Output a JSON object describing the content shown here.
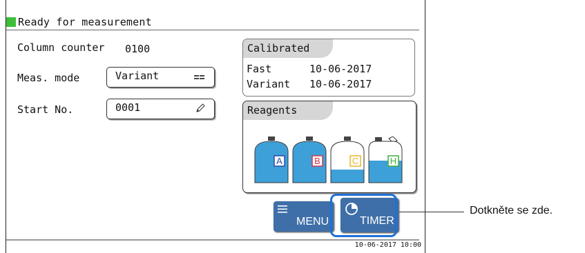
{
  "status": {
    "text": "Ready for measurement",
    "indicator_color": "#3fbe3a"
  },
  "left": {
    "column_counter_label": "Column counter",
    "column_counter_value": "0100",
    "meas_mode_label": "Meas. mode",
    "meas_mode_value": "Variant",
    "start_no_label": "Start No.",
    "start_no_value": "0001"
  },
  "calibrated": {
    "title": "Calibrated",
    "rows": [
      {
        "name": "Fast",
        "date": "10-06-2017"
      },
      {
        "name": "Variant",
        "date": "10-06-2017"
      }
    ]
  },
  "reagents": {
    "title": "Reagents",
    "bottles": [
      {
        "label": "A",
        "label_color": "#2a4aa8",
        "level": 0.9
      },
      {
        "label": "B",
        "label_color": "#d8364a",
        "level": 0.95
      },
      {
        "label": "C",
        "label_color": "#e8b72a",
        "level": 0.3
      },
      {
        "label": "H",
        "label_color": "#3fae3a",
        "level": 0.55
      }
    ]
  },
  "buttons": {
    "menu_label": "MENU",
    "menu_icon": "hamburger-icon",
    "timer_label": "TIMER",
    "timer_icon": "clock-icon",
    "color": "#3f6fa8"
  },
  "timestamp": "10-06-2017 10:00",
  "callout": {
    "text": "Dotkněte se zde.",
    "highlight_color": "#1e6fd9"
  }
}
